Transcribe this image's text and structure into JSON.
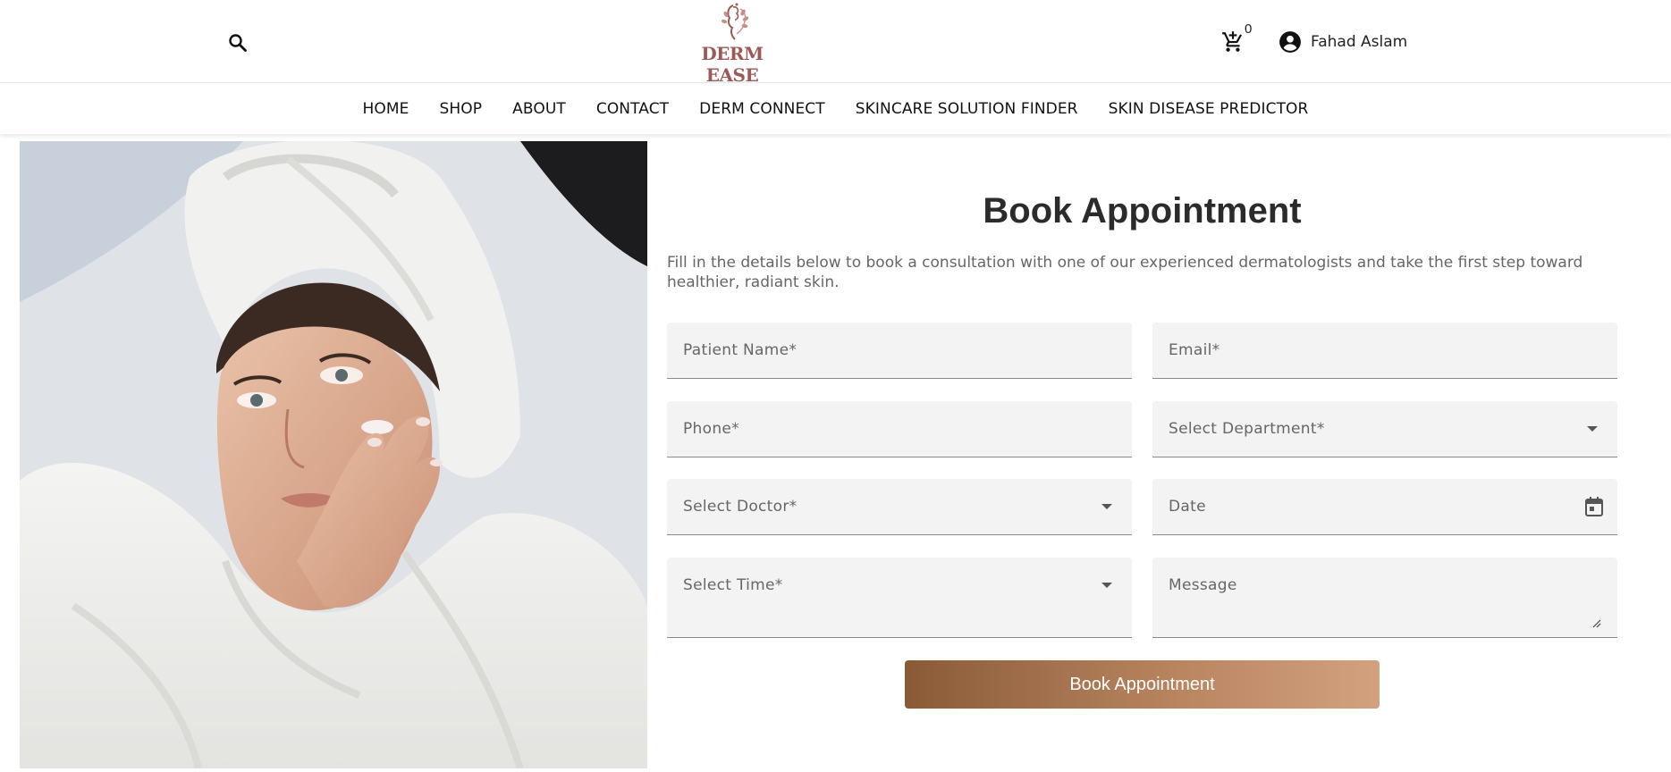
{
  "header": {
    "logo_text": "DERM EASE",
    "cart_count": "0",
    "user_name": "Fahad Aslam",
    "icons": {
      "search": "search-icon",
      "cart": "cart-icon",
      "user": "account-circle-icon"
    }
  },
  "nav": {
    "items": [
      {
        "label": "HOME"
      },
      {
        "label": "SHOP"
      },
      {
        "label": "ABOUT"
      },
      {
        "label": "CONTACT"
      },
      {
        "label": "DERM CONNECT"
      },
      {
        "label": "SKINCARE SOLUTION FINDER"
      },
      {
        "label": "SKIN DISEASE PREDICTOR"
      }
    ]
  },
  "form": {
    "title": "Book Appointment",
    "description": "Fill in the details below to book a consultation with one of our experienced dermatologists and take the first step toward healthier, radiant skin.",
    "fields": {
      "patient_name": "Patient Name*",
      "email": "Email*",
      "phone": "Phone*",
      "department": "Select Department*",
      "doctor": "Select Doctor*",
      "date": "Date",
      "time": "Select Time*",
      "message": "Message"
    },
    "submit_label": "Book Appointment"
  },
  "colors": {
    "brand": "#9b5a57",
    "button_gradient_start": "#8a5a37",
    "button_gradient_end": "#d4a17f",
    "field_bg": "#f3f3f3"
  }
}
